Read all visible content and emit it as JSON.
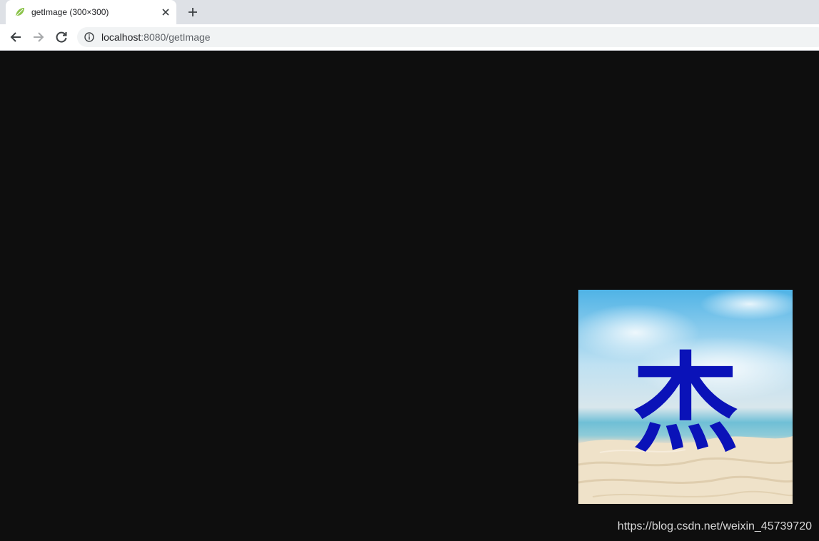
{
  "tab": {
    "title": "getImage (300×300)",
    "favicon": "spring-leaf-icon"
  },
  "toolbar": {
    "back_icon": "back-arrow-icon",
    "forward_icon": "forward-arrow-icon",
    "reload_icon": "reload-icon",
    "site_info_icon": "info-icon"
  },
  "address": {
    "host": "localhost",
    "rest": ":8080/getImage"
  },
  "image": {
    "character": "杰",
    "character_color": "#0a12b8"
  },
  "watermark": {
    "text": "https://blog.csdn.net/weixin_45739720"
  }
}
